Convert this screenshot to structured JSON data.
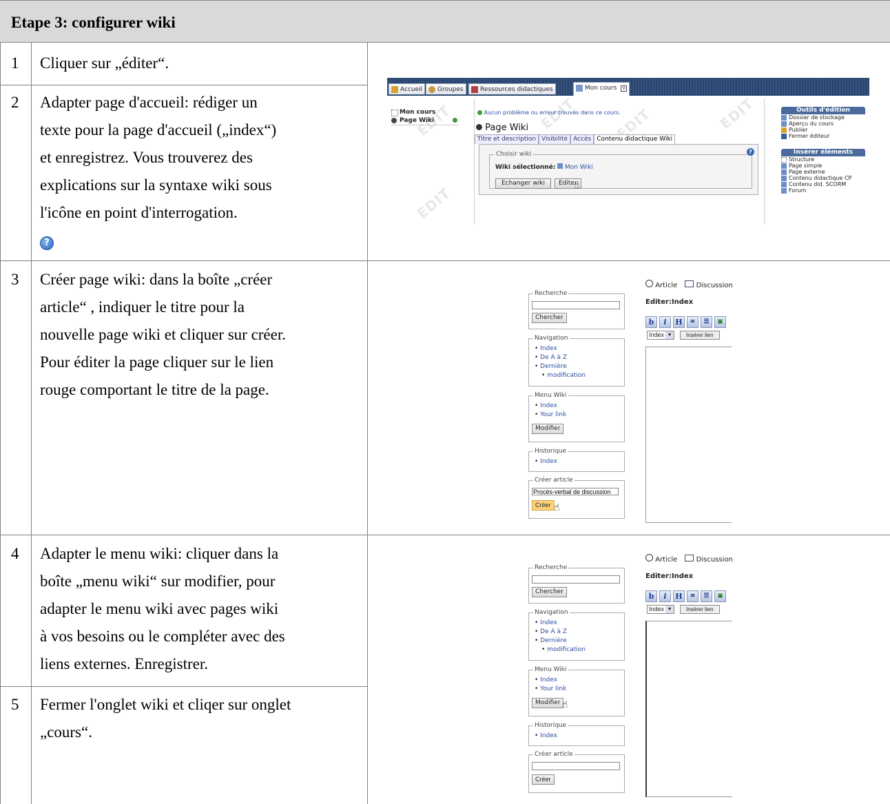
{
  "title": "Etape 3: configurer wiki",
  "steps": [
    {
      "num": "1",
      "lines": [
        "Cliquer sur „éditer“."
      ]
    },
    {
      "num": "2",
      "lines": [
        "Adapter page d'accueil: rédiger un",
        "texte pour la page d'accueil („index“)",
        "et enregistrez. Vous trouverez des",
        "explications sur la syntaxe wiki sous",
        "l'icône en point d'interrogation."
      ]
    },
    {
      "num": "3",
      "lines": [
        "Créer page wiki: dans la boîte „créer",
        "article“ , indiquer le titre pour la",
        "nouvelle page wiki et cliquer sur créer.",
        "Pour éditer la page cliquer sur le lien",
        "rouge comportant le titre de la page."
      ]
    },
    {
      "num": "4",
      "lines": [
        "Adapter le menu wiki: cliquer dans la",
        "boîte „menu wiki“ sur modifier, pour",
        "adapter le menu wiki avec pages wiki",
        "à vos besoins ou le compléter avec des",
        "liens externes. Enregistrer."
      ]
    },
    {
      "num": "5",
      "lines": [
        "Fermer l'onglet wiki et cliqer sur onglet",
        "„cours“."
      ]
    }
  ],
  "course_editor": {
    "tabs": [
      "Accueil",
      "Groupes",
      "Ressources didactiques",
      "Mon cours"
    ],
    "left_nav": [
      "Mon cours",
      "Page Wiki"
    ],
    "status_message": "Aucun problème ou erreur trouvés dans ce cours.",
    "page_title": "Page Wiki",
    "subtabs": [
      "Titre et description",
      "Visibilité",
      "Accès",
      "Contenu didactique Wiki"
    ],
    "choose_legend": "Choisir wiki",
    "selected_label": "Wiki sélectionné:",
    "selected_value": "Mon Wiki",
    "exchange_button": "Echanger wiki",
    "edit_button": "Editer",
    "watermark": "EDIT",
    "tools_header": "Outils d'édition",
    "tools": [
      "Dossier de stockage",
      "Aperçu du cours",
      "Publier",
      "Fermer éditeur"
    ],
    "insert_header": "Insérer éléments",
    "insert_items": [
      "Structure",
      "Page simple",
      "Page externe",
      "Contenu didactique CP",
      "Contenu did. SCORM",
      "Forum"
    ]
  },
  "wiki": {
    "search_legend": "Recherche",
    "search_button": "Chercher",
    "navigation_legend": "Navigation",
    "navigation_items": [
      "Index",
      "De A à Z",
      "Dernière",
      "modification"
    ],
    "menu_legend": "Menu Wiki",
    "menu_items": [
      "Index",
      "Your link"
    ],
    "modify_button": "Modifier",
    "history_legend": "Historique",
    "history_items": [
      "Index"
    ],
    "create_legend": "Créer article",
    "create_value": "Procès-verbal de discussion",
    "create_button": "Créer",
    "article_tab": "Article",
    "discussion_tab": "Discussion",
    "editor_title": "Editer:Index",
    "toolbar": [
      "b",
      "i",
      "H",
      "≡",
      "☰",
      "▣"
    ],
    "index_select": "Index",
    "insert_link_button": "Insérer lien"
  }
}
